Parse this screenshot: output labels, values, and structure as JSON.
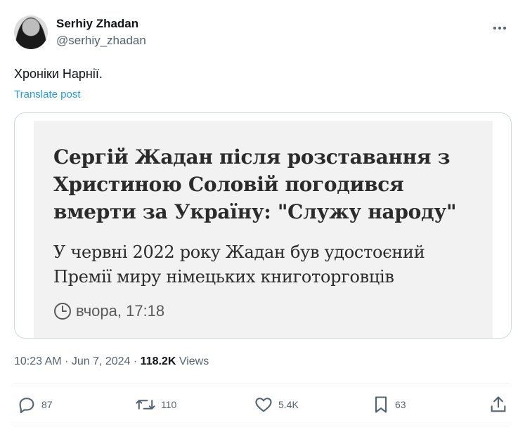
{
  "author": {
    "display_name": "Serhiy Zhadan",
    "handle": "@serhiy_zhadan"
  },
  "icons": {
    "more": "more-horizontal-icon",
    "clock": "clock-icon",
    "reply": "reply-icon",
    "retweet": "retweet-icon",
    "like": "heart-icon",
    "bookmark": "bookmark-icon",
    "share": "share-icon"
  },
  "post": {
    "text": "Хроніки Нарнії.",
    "translate_label": "Translate post"
  },
  "card": {
    "headline": "Сергій Жадан після розставання з Христиною Соловій погодився вмерти за Україну: \"Служу народу\"",
    "subheadline": "У червні 2022 року Жадан був удостоєний Премії миру німецьких книготорговців",
    "timestamp": "вчора, 17:18"
  },
  "meta": {
    "time": "10:23 AM",
    "separator": " · ",
    "date": "Jun 7, 2024",
    "views_count": "118.2K",
    "views_label": "Views"
  },
  "actions": {
    "replies": "87",
    "reposts": "110",
    "likes": "5.4K",
    "bookmarks": "63"
  },
  "colors": {
    "text_primary": "#0f1419",
    "text_secondary": "#536471",
    "link": "#1d9bf0",
    "border": "#cfd9de",
    "card_bg": "#f2f2f2"
  }
}
